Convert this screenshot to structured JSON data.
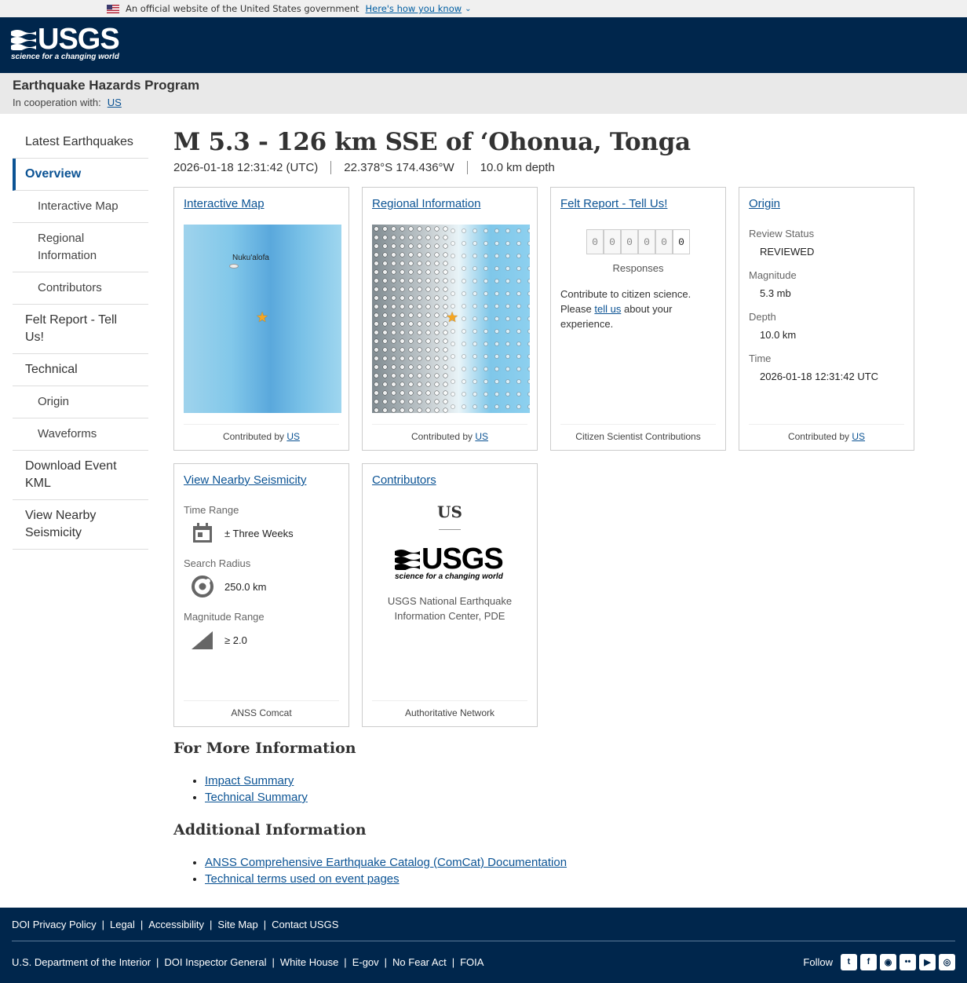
{
  "banner": {
    "text": "An official website of the United States government",
    "link": "Here's how you know"
  },
  "header": {
    "logo_word": "USGS",
    "logo_tagline": "science for a changing world"
  },
  "program": {
    "name": "Earthquake Hazards Program",
    "coop_label": "In cooperation with:",
    "coop_link": "US"
  },
  "sidebar": {
    "items": [
      {
        "label": "Latest Earthquakes"
      },
      {
        "label": "Overview"
      },
      {
        "label": "Interactive Map"
      },
      {
        "label": "Regional Information"
      },
      {
        "label": "Contributors"
      },
      {
        "label": "Felt Report - Tell Us!"
      },
      {
        "label": "Technical"
      },
      {
        "label": "Origin"
      },
      {
        "label": "Waveforms"
      },
      {
        "label": "Download Event KML"
      },
      {
        "label": "View Nearby Seismicity"
      }
    ]
  },
  "event": {
    "title": "M 5.3 - 126 km SSE of ‘Ohonua, Tonga",
    "time": "2026-01-18 12:31:42 (UTC)",
    "location": "22.378°S 174.436°W",
    "depth": "10.0 km depth"
  },
  "cards": {
    "interactive_map": {
      "title": "Interactive Map",
      "map_label": "Nuku'alofa",
      "footer_prefix": "Contributed by",
      "footer_link": "US"
    },
    "regional": {
      "title": "Regional Information",
      "footer_prefix": "Contributed by",
      "footer_link": "US"
    },
    "felt": {
      "title": "Felt Report - Tell Us!",
      "digits": [
        "0",
        "0",
        "0",
        "0",
        "0",
        "0"
      ],
      "responses": "Responses",
      "text_1": "Contribute to citizen science. Please",
      "text_link": "tell us",
      "text_2": "about your experience.",
      "footer": "Citizen Scientist Contributions"
    },
    "origin": {
      "title": "Origin",
      "review_label": "Review Status",
      "review_value": "REVIEWED",
      "mag_label": "Magnitude",
      "mag_value": "5.3 mb",
      "depth_label": "Depth",
      "depth_value": "10.0 km",
      "time_label": "Time",
      "time_value": "2026-01-18 12:31:42 UTC",
      "footer_prefix": "Contributed by",
      "footer_link": "US"
    },
    "seismicity": {
      "title": "View Nearby Seismicity",
      "time_label": "Time Range",
      "time_value": "± Three Weeks",
      "radius_label": "Search Radius",
      "radius_value": "250.0 km",
      "mag_label": "Magnitude Range",
      "mag_value": "≥ 2.0",
      "footer": "ANSS Comcat"
    },
    "contributors": {
      "title": "Contributors",
      "code": "US",
      "logo_word": "USGS",
      "logo_tagline": "science for a changing world",
      "name": "USGS National Earthquake Information Center, PDE",
      "footer": "Authoritative Network"
    }
  },
  "more_info": {
    "heading": "For More Information",
    "links": [
      "Impact Summary",
      "Technical Summary"
    ]
  },
  "additional_info": {
    "heading": "Additional Information",
    "links": [
      "ANSS Comprehensive Earthquake Catalog (ComCat) Documentation",
      "Technical terms used on event pages"
    ]
  },
  "footer": {
    "row1": [
      "DOI Privacy Policy",
      "Legal",
      "Accessibility",
      "Site Map",
      "Contact USGS"
    ],
    "row2": [
      "U.S. Department of the Interior",
      "DOI Inspector General",
      "White House",
      "E-gov",
      "No Fear Act",
      "FOIA"
    ],
    "follow": "Follow",
    "social_icons": [
      "twitter-icon",
      "facebook-icon",
      "github-icon",
      "flickr-icon",
      "youtube-icon",
      "instagram-icon"
    ]
  },
  "colors": {
    "header_bg": "#00264c",
    "link": "#0b5394",
    "map_water": "#82c8ea",
    "star": "#f5a623"
  }
}
